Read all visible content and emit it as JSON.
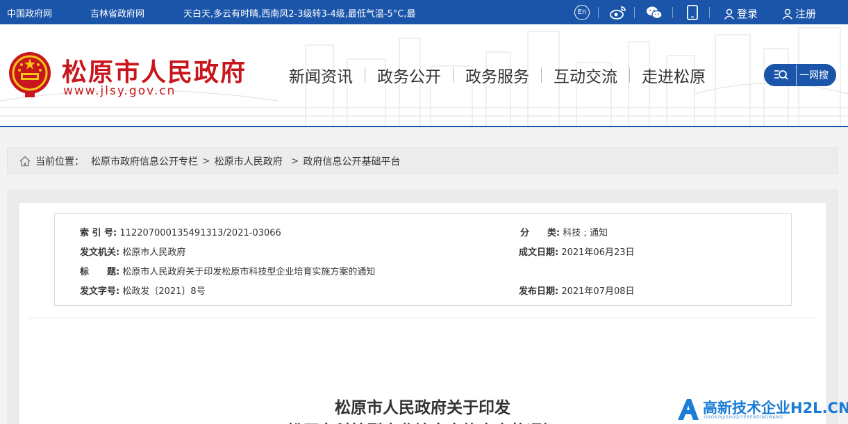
{
  "topbar": {
    "links": [
      "中国政府网",
      "吉林省政府网"
    ],
    "weather": "天白天,多云有时晴,西南风2-3级转3-4级,最低气温-5°C,最",
    "en_label": "En",
    "icons": [
      "en-icon",
      "weibo-icon",
      "wechat-icon",
      "mobile-icon"
    ],
    "login": "登录",
    "register": "注册",
    "bg_color": "#1a55a9"
  },
  "header": {
    "site_title": "松原市人民政府",
    "site_url": "www.jlsy.gov.cn",
    "nav": [
      "新闻资讯",
      "政务公开",
      "政务服务",
      "互动交流",
      "走进松原"
    ],
    "search_label": "一网搜",
    "title_color": "#c8161d"
  },
  "breadcrumb": {
    "prefix": "当前位置：",
    "items": [
      "松原市政府信息公开专栏",
      "松原市人民政府",
      "政府信息公开基础平台"
    ],
    "separator": ">"
  },
  "meta": {
    "index_label": "索 引 号:",
    "index_value": "112207000135491313/2021-03066",
    "category_label": "分　　类:",
    "category_value": "科技 ; 通知",
    "issuer_label": "发文机关:",
    "issuer_value": "松原市人民政府",
    "created_label": "成文日期:",
    "created_value": "2021年06月23日",
    "title_label": "标　　题:",
    "title_value": "松原市人民政府关于印发松原市科技型企业培育实施方案的通知",
    "docno_label": "发文字号:",
    "docno_value": "松政发〔2021〕8号",
    "published_label": "发布日期:",
    "published_value": "2021年07月08日"
  },
  "document": {
    "title_line1": "松原市人民政府关于印发",
    "title_line2": "松原市科技型企业培育实施方案的通知"
  },
  "watermark": {
    "text": "高新技术企业H2L.CN",
    "sub": "GAOXINJISHUQIYERENDINGWANG"
  }
}
